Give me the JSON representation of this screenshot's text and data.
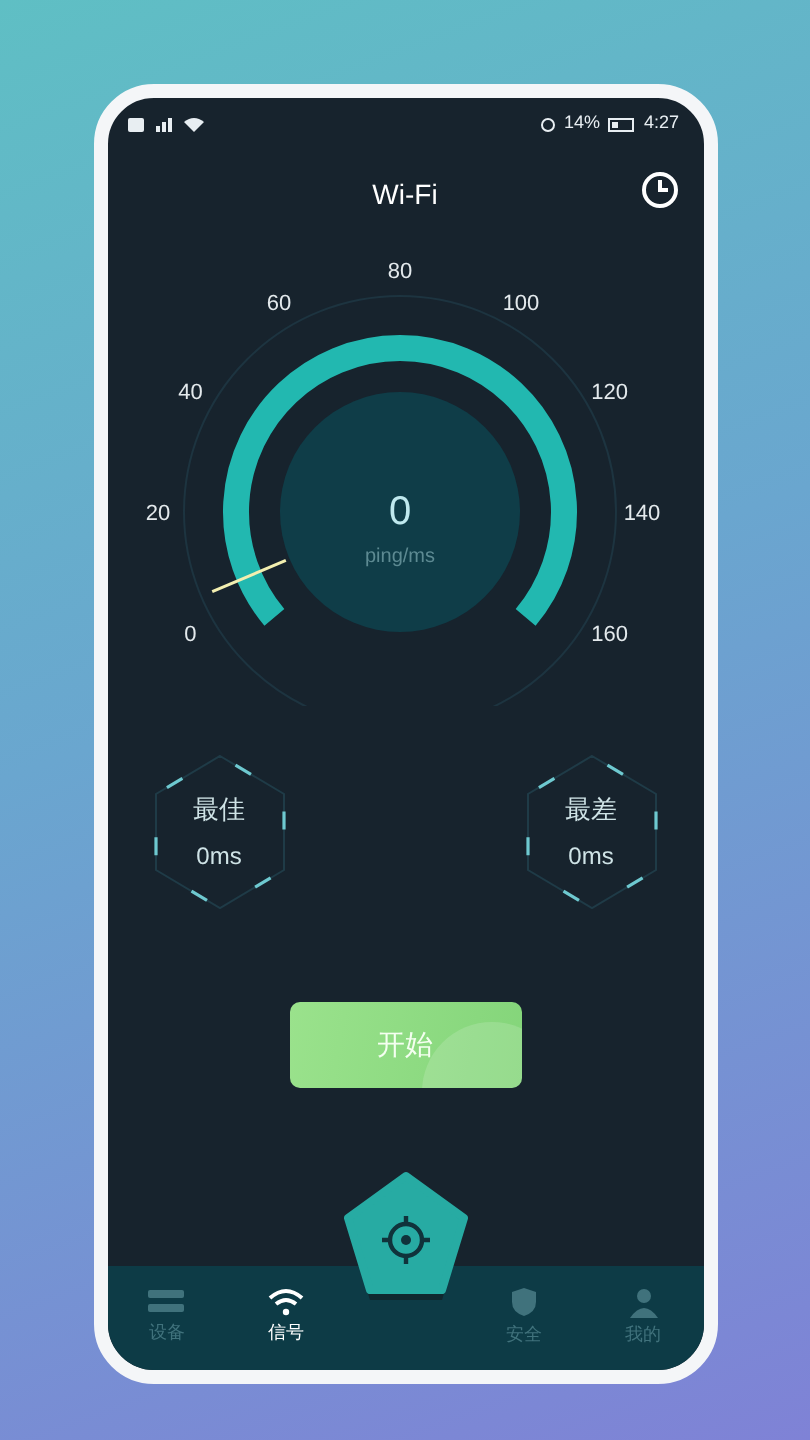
{
  "status_bar": {
    "battery": "14%",
    "time": "4:27"
  },
  "header": {
    "title": "Wi-Fi"
  },
  "gauge": {
    "scale": [
      "0",
      "20",
      "40",
      "60",
      "80",
      "100",
      "120",
      "140",
      "160"
    ],
    "value": "0",
    "unit": "ping/ms"
  },
  "stats": [
    {
      "label": "最佳",
      "value": "0ms"
    },
    {
      "label": "最差",
      "value": "0ms"
    }
  ],
  "start_button": "开始",
  "nav": [
    {
      "kind": "devices",
      "label": "设备",
      "selected": false
    },
    {
      "kind": "signal",
      "label": "信号",
      "selected": true
    },
    {
      "kind": "scan",
      "selected": false
    },
    {
      "kind": "security",
      "label": "安全",
      "selected": false
    },
    {
      "kind": "profile",
      "label": "我的",
      "selected": false
    }
  ]
}
